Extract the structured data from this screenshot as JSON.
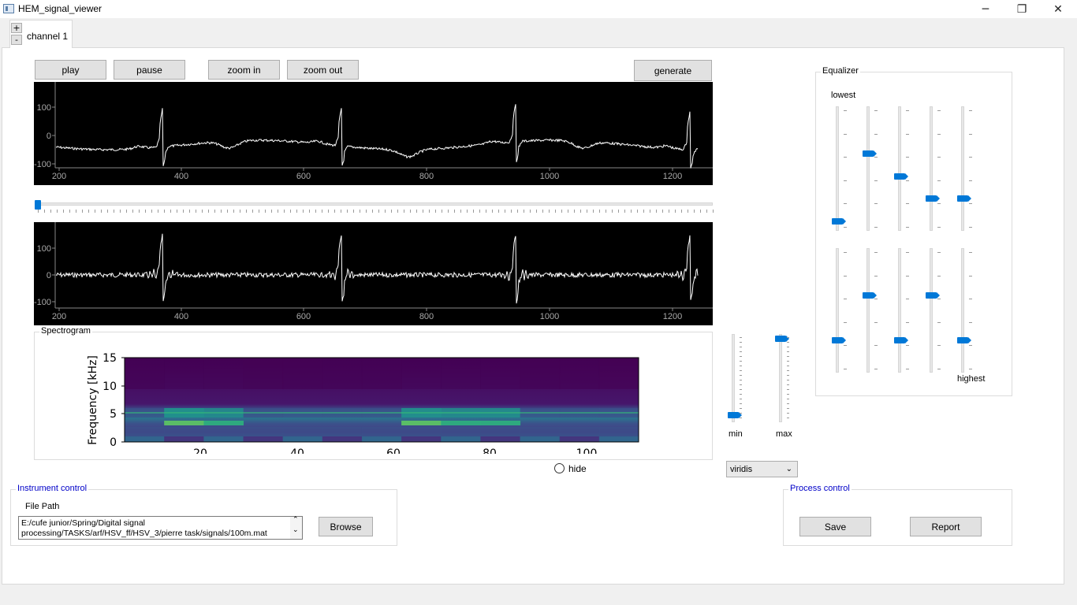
{
  "window": {
    "title": "HEM_signal_viewer",
    "minimize": "─",
    "maximize": "❐",
    "close": "✕"
  },
  "tabs": {
    "add": "+",
    "remove": "-",
    "channel": "channel 1"
  },
  "toolbar": {
    "play": "play",
    "pause": "pause",
    "zoom_in": "zoom in",
    "zoom_out": "zoom out",
    "generate": "generate"
  },
  "plot_top": {
    "yticks": [
      "100",
      "0",
      "-100"
    ],
    "xticks": [
      "200",
      "400",
      "600",
      "800",
      "1000",
      "1200"
    ]
  },
  "plot_bottom": {
    "yticks": [
      "100",
      "0",
      "-100"
    ],
    "xticks": [
      "200",
      "400",
      "600",
      "800",
      "1000",
      "1200"
    ]
  },
  "time_slider": {
    "value": 0
  },
  "spectrogram": {
    "title": "Spectrogram",
    "ylabel": "Frequency [kHz]",
    "yticks": [
      "15",
      "10",
      "5",
      "0"
    ],
    "xticks": [
      "20",
      "40",
      "60",
      "80",
      "100"
    ],
    "hide_label": "hide"
  },
  "color_range": {
    "min_label": "min",
    "max_label": "max",
    "min_value": 0.05,
    "max_value": 0.98
  },
  "colormap": {
    "selected": "viridis",
    "arrow": "⌄"
  },
  "equalizer": {
    "title": "Equalizer",
    "lowest_label": "lowest",
    "highest_label": "highest",
    "bands": [
      0.05,
      0.63,
      0.43,
      0.24,
      0.24,
      0.24,
      0.63,
      0.24,
      0.63,
      0.24
    ]
  },
  "instrument_control": {
    "title": "Instrument control",
    "file_path_label": "File Path",
    "file_path": "E:/cufe junior/Spring/Digital signal processing/TASKS/arf/HSV_ff/HSV_3/pierre task/signals/100m.mat",
    "browse": "Browse",
    "scroll_up": "⌃",
    "scroll_down": "⌄"
  },
  "process_control": {
    "title": "Process control",
    "save": "Save",
    "report": "Report"
  },
  "colors": {
    "accent": "#0078d7",
    "group_title_blue": "#0000c8"
  }
}
